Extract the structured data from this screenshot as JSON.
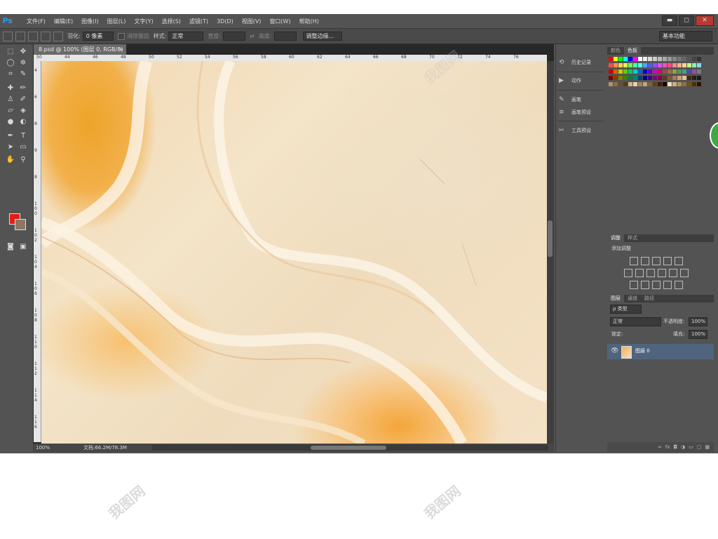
{
  "app": {
    "logo": "Ps"
  },
  "menu": [
    "文件(F)",
    "编辑(E)",
    "图像(I)",
    "图层(L)",
    "文字(Y)",
    "选择(S)",
    "滤镜(T)",
    "3D(D)",
    "视图(V)",
    "窗口(W)",
    "帮助(H)"
  ],
  "window_buttons": {
    "minimize": "▬",
    "restore": "◻",
    "close": "✕"
  },
  "options_bar": {
    "feather_label": "羽化:",
    "feather_value": "0 像素",
    "antialias_label": "消除锯齿",
    "style_label": "样式:",
    "style_value": "正常",
    "width_label": "宽度:",
    "height_label": "高度:",
    "refine_button": "调整边缘...",
    "workspace": "基本功能"
  },
  "document": {
    "tab_title": "8.psd @ 100% (图层 0, RGB/8)",
    "tab_close": "×",
    "zoom": "100%",
    "doc_info": "文档:66.2M/78.3M"
  },
  "ruler_top": [
    "50",
    "44",
    "46",
    "48",
    "50",
    "52",
    "54",
    "56",
    "58",
    "60",
    "62",
    "64",
    "66",
    "68",
    "70",
    "72",
    "74",
    "76"
  ],
  "ruler_left": [
    "4",
    "6",
    "8",
    "9",
    "8",
    "1 0 0",
    "1 0 2",
    "1 0 4",
    "1 0 6",
    "1 0 8",
    "1 1 0",
    "1 1 2",
    "1 1 4",
    "1 1 6"
  ],
  "mid_panel": {
    "items": [
      {
        "icon": "history-icon",
        "label": "历史记录"
      },
      {
        "icon": "actions-icon",
        "label": "动作"
      },
      {
        "icon": "brush-icon",
        "label": "画笔"
      },
      {
        "icon": "brush-presets-icon",
        "label": "画笔预设"
      },
      {
        "icon": "tool-presets-icon",
        "label": "工具预设"
      }
    ]
  },
  "color_panel": {
    "tabs": [
      "颜色",
      "色板"
    ]
  },
  "adjust_panel": {
    "tabs": [
      "调整",
      "样式"
    ],
    "title": "添加调整"
  },
  "layers_panel": {
    "tabs": [
      "图层",
      "通道",
      "路径"
    ],
    "filter_kind": "ρ 类型",
    "blend_mode": "正常",
    "opacity_label": "不透明度:",
    "opacity_value": "100%",
    "lock_label": "锁定:",
    "fill_label": "填充:",
    "fill_value": "100%",
    "layer_name": "图层 0"
  },
  "colors": {
    "fg": "#e41b17",
    "bg": "#8b7763",
    "layer_highlight": "#4f647e"
  }
}
